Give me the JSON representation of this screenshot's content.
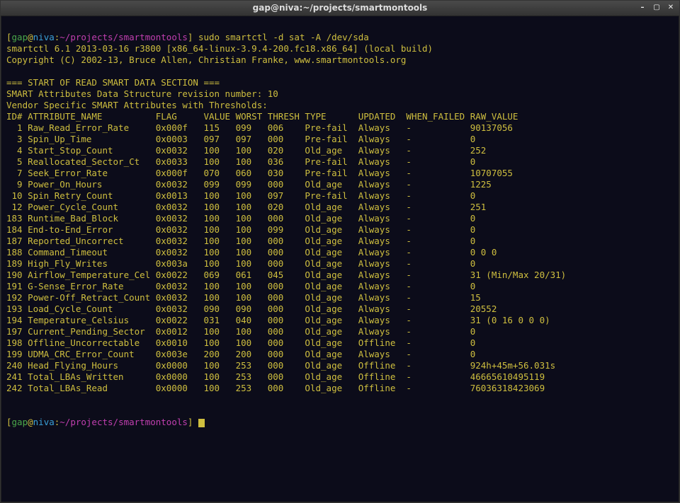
{
  "title": "gap@niva:~/projects/smartmontools",
  "prompt": {
    "user": "gap",
    "host": "niva",
    "path": "~/projects/smartmontools",
    "command": "sudo smartctl -d sat -A /dev/sda"
  },
  "header": {
    "line1": "smartctl 6.1 2013-03-16 r3800 [x86_64-linux-3.9.4-200.fc18.x86_64] (local build)",
    "line2": "Copyright (C) 2002-13, Bruce Allen, Christian Franke, www.smartmontools.org"
  },
  "section": {
    "banner": "=== START OF READ SMART DATA SECTION ===",
    "rev": "SMART Attributes Data Structure revision number: 10",
    "vendor": "Vendor Specific SMART Attributes with Thresholds:",
    "cols": "ID# ATTRIBUTE_NAME          FLAG     VALUE WORST THRESH TYPE      UPDATED  WHEN_FAILED RAW_VALUE"
  },
  "rows": [
    {
      "id": "1",
      "name": "Raw_Read_Error_Rate",
      "flag": "0x000f",
      "value": "115",
      "worst": "099",
      "thresh": "006",
      "type": "Pre-fail",
      "updated": "Always",
      "when": "-",
      "raw": "90137056"
    },
    {
      "id": "3",
      "name": "Spin_Up_Time",
      "flag": "0x0003",
      "value": "097",
      "worst": "097",
      "thresh": "000",
      "type": "Pre-fail",
      "updated": "Always",
      "when": "-",
      "raw": "0"
    },
    {
      "id": "4",
      "name": "Start_Stop_Count",
      "flag": "0x0032",
      "value": "100",
      "worst": "100",
      "thresh": "020",
      "type": "Old_age",
      "updated": "Always",
      "when": "-",
      "raw": "252"
    },
    {
      "id": "5",
      "name": "Reallocated_Sector_Ct",
      "flag": "0x0033",
      "value": "100",
      "worst": "100",
      "thresh": "036",
      "type": "Pre-fail",
      "updated": "Always",
      "when": "-",
      "raw": "0"
    },
    {
      "id": "7",
      "name": "Seek_Error_Rate",
      "flag": "0x000f",
      "value": "070",
      "worst": "060",
      "thresh": "030",
      "type": "Pre-fail",
      "updated": "Always",
      "when": "-",
      "raw": "10707055"
    },
    {
      "id": "9",
      "name": "Power_On_Hours",
      "flag": "0x0032",
      "value": "099",
      "worst": "099",
      "thresh": "000",
      "type": "Old_age",
      "updated": "Always",
      "when": "-",
      "raw": "1225"
    },
    {
      "id": "10",
      "name": "Spin_Retry_Count",
      "flag": "0x0013",
      "value": "100",
      "worst": "100",
      "thresh": "097",
      "type": "Pre-fail",
      "updated": "Always",
      "when": "-",
      "raw": "0"
    },
    {
      "id": "12",
      "name": "Power_Cycle_Count",
      "flag": "0x0032",
      "value": "100",
      "worst": "100",
      "thresh": "020",
      "type": "Old_age",
      "updated": "Always",
      "when": "-",
      "raw": "251"
    },
    {
      "id": "183",
      "name": "Runtime_Bad_Block",
      "flag": "0x0032",
      "value": "100",
      "worst": "100",
      "thresh": "000",
      "type": "Old_age",
      "updated": "Always",
      "when": "-",
      "raw": "0"
    },
    {
      "id": "184",
      "name": "End-to-End_Error",
      "flag": "0x0032",
      "value": "100",
      "worst": "100",
      "thresh": "099",
      "type": "Old_age",
      "updated": "Always",
      "when": "-",
      "raw": "0"
    },
    {
      "id": "187",
      "name": "Reported_Uncorrect",
      "flag": "0x0032",
      "value": "100",
      "worst": "100",
      "thresh": "000",
      "type": "Old_age",
      "updated": "Always",
      "when": "-",
      "raw": "0"
    },
    {
      "id": "188",
      "name": "Command_Timeout",
      "flag": "0x0032",
      "value": "100",
      "worst": "100",
      "thresh": "000",
      "type": "Old_age",
      "updated": "Always",
      "when": "-",
      "raw": "0 0 0"
    },
    {
      "id": "189",
      "name": "High_Fly_Writes",
      "flag": "0x003a",
      "value": "100",
      "worst": "100",
      "thresh": "000",
      "type": "Old_age",
      "updated": "Always",
      "when": "-",
      "raw": "0"
    },
    {
      "id": "190",
      "name": "Airflow_Temperature_Cel",
      "flag": "0x0022",
      "value": "069",
      "worst": "061",
      "thresh": "045",
      "type": "Old_age",
      "updated": "Always",
      "when": "-",
      "raw": "31 (Min/Max 20/31)"
    },
    {
      "id": "191",
      "name": "G-Sense_Error_Rate",
      "flag": "0x0032",
      "value": "100",
      "worst": "100",
      "thresh": "000",
      "type": "Old_age",
      "updated": "Always",
      "when": "-",
      "raw": "0"
    },
    {
      "id": "192",
      "name": "Power-Off_Retract_Count",
      "flag": "0x0032",
      "value": "100",
      "worst": "100",
      "thresh": "000",
      "type": "Old_age",
      "updated": "Always",
      "when": "-",
      "raw": "15"
    },
    {
      "id": "193",
      "name": "Load_Cycle_Count",
      "flag": "0x0032",
      "value": "090",
      "worst": "090",
      "thresh": "000",
      "type": "Old_age",
      "updated": "Always",
      "when": "-",
      "raw": "20552"
    },
    {
      "id": "194",
      "name": "Temperature_Celsius",
      "flag": "0x0022",
      "value": "031",
      "worst": "040",
      "thresh": "000",
      "type": "Old_age",
      "updated": "Always",
      "when": "-",
      "raw": "31 (0 16 0 0 0)"
    },
    {
      "id": "197",
      "name": "Current_Pending_Sector",
      "flag": "0x0012",
      "value": "100",
      "worst": "100",
      "thresh": "000",
      "type": "Old_age",
      "updated": "Always",
      "when": "-",
      "raw": "0"
    },
    {
      "id": "198",
      "name": "Offline_Uncorrectable",
      "flag": "0x0010",
      "value": "100",
      "worst": "100",
      "thresh": "000",
      "type": "Old_age",
      "updated": "Offline",
      "when": "-",
      "raw": "0"
    },
    {
      "id": "199",
      "name": "UDMA_CRC_Error_Count",
      "flag": "0x003e",
      "value": "200",
      "worst": "200",
      "thresh": "000",
      "type": "Old_age",
      "updated": "Always",
      "when": "-",
      "raw": "0"
    },
    {
      "id": "240",
      "name": "Head_Flying_Hours",
      "flag": "0x0000",
      "value": "100",
      "worst": "253",
      "thresh": "000",
      "type": "Old_age",
      "updated": "Offline",
      "when": "-",
      "raw": "924h+45m+56.031s"
    },
    {
      "id": "241",
      "name": "Total_LBAs_Written",
      "flag": "0x0000",
      "value": "100",
      "worst": "253",
      "thresh": "000",
      "type": "Old_age",
      "updated": "Offline",
      "when": "-",
      "raw": "46665610495119"
    },
    {
      "id": "242",
      "name": "Total_LBAs_Read",
      "flag": "0x0000",
      "value": "100",
      "worst": "253",
      "thresh": "000",
      "type": "Old_age",
      "updated": "Offline",
      "when": "-",
      "raw": "76036318423069"
    }
  ],
  "prompt2": {
    "user": "gap",
    "host": "niva",
    "path": "~/projects/smartmontools"
  },
  "controls": {
    "min": "–",
    "max": "▢",
    "close": "✕"
  }
}
